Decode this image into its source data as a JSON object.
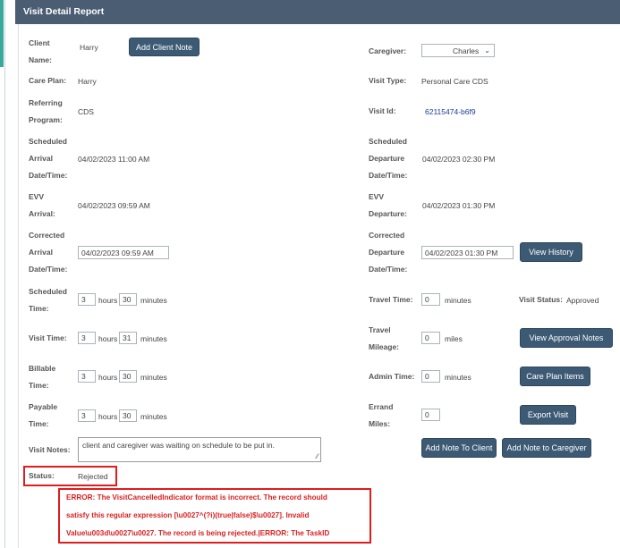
{
  "header": {
    "title": "Visit Detail Report"
  },
  "labels": {
    "client_name": "Client Name:",
    "caregiver": "Caregiver:",
    "care_plan": "Care Plan:",
    "visit_type": "Visit Type:",
    "referring_program": "Referring Program:",
    "visit_id": "Visit Id:",
    "scheduled_arrival": "Scheduled Arrival Date/Time:",
    "scheduled_departure": "Scheduled Departure Date/Time:",
    "evv_arrival": "EVV Arrival:",
    "evv_departure": "EVV Departure:",
    "corrected_arrival": "Corrected Arrival Date/Time:",
    "corrected_departure": "Corrected Departure Date/Time:",
    "scheduled_time": "Scheduled Time:",
    "travel_time": "Travel Time:",
    "visit_status": "Visit Status:",
    "visit_time": "Visit Time:",
    "travel_mileage": "Travel Mileage:",
    "billable_time": "Billable Time:",
    "admin_time": "Admin Time:",
    "payable_time": "Payable Time:",
    "errand_miles": "Errand Miles:",
    "visit_notes": "Visit Notes:",
    "status": "Status:"
  },
  "values": {
    "client_name": "Harry",
    "caregiver": "Charles",
    "care_plan": "Harry",
    "visit_type": "Personal Care CDS",
    "referring_program": "CDS",
    "visit_id": "62115474-b6f9",
    "scheduled_arrival": "04/02/2023 11:00 AM",
    "scheduled_departure": "04/02/2023 02:30 PM",
    "evv_arrival": "04/02/2023 09:59 AM",
    "evv_departure": "04/02/2023 01:30 PM",
    "corrected_arrival": "04/02/2023 09:59 AM",
    "corrected_departure": "04/02/2023 01:30 PM",
    "scheduled_hours": "3",
    "scheduled_minutes": "30",
    "travel_time": "0",
    "visit_status": "Approved",
    "visit_hours": "3",
    "visit_minutes": "31",
    "travel_mileage": "0",
    "billable_hours": "3",
    "billable_minutes": "30",
    "admin_time": "0",
    "payable_hours": "3",
    "payable_minutes": "30",
    "errand_miles": "0",
    "visit_notes": "client and caregiver was waiting on schedule to be put in.",
    "status": "Rejected"
  },
  "units": {
    "hours": "hours",
    "minutes": "minutes",
    "miles": "miles"
  },
  "buttons": {
    "add_client_note": "Add Client Note",
    "view_history": "View History",
    "view_approval_notes": "View Approval Notes",
    "care_plan_items": "Care Plan Items",
    "export_visit": "Export Visit",
    "add_note_to_client": "Add Note To Client",
    "add_note_to_caregiver": "Add Note to Caregiver"
  },
  "error": {
    "line1": "ERROR: The VisitCancelledIndicator format is incorrect. The record should",
    "line2": "satisfy this regular expression [\\u0027^(?i)(true|false)$\\u0027]. Invalid",
    "line3": "Value\\u003d\\u0027\\u0027. The record is being rejected.|ERROR: The TaskID"
  },
  "colors": {
    "header_bg": "#4a5d72",
    "button_bg": "#3d5a74",
    "error_red": "#d92020",
    "visit_id_blue": "#1a3a9c"
  }
}
